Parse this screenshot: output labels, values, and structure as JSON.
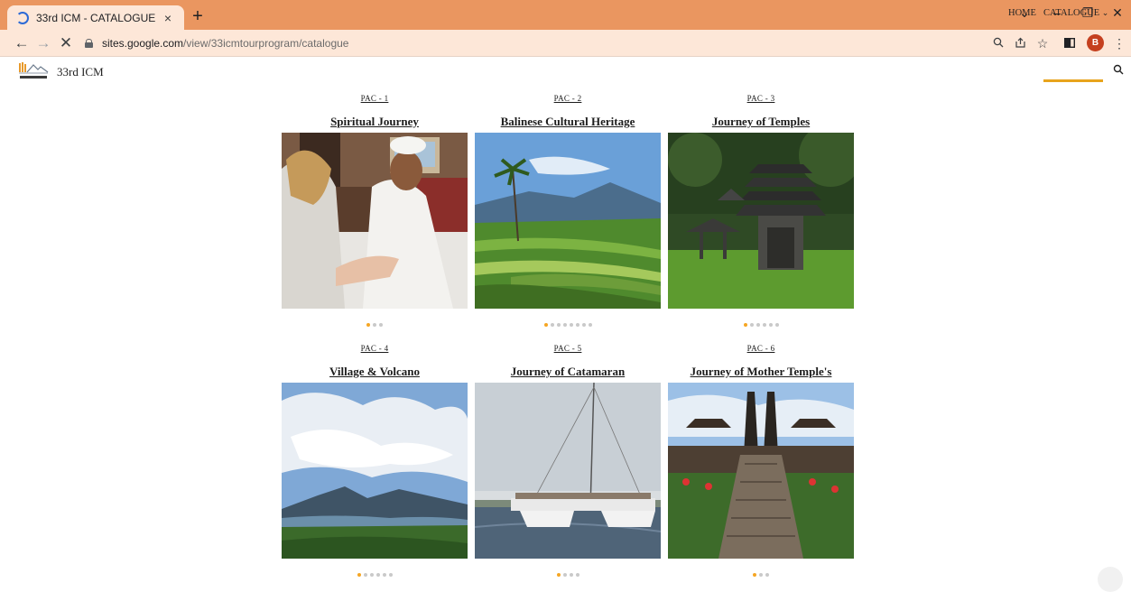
{
  "browser": {
    "tab_title": "33rd ICM - CATALOGUE",
    "tab_close": "×",
    "new_tab": "+",
    "url_host": "sites.google.com",
    "url_path": "/view/33icmtourprogram/catalogue",
    "profile_initial": "B",
    "window_minimize": "–",
    "window_restore": "❐",
    "window_close": "✕",
    "tab_search": "⌄"
  },
  "site": {
    "name": "33rd ICM",
    "nav": {
      "home": "HOME",
      "catalogue": "CATALOGUE"
    }
  },
  "packages": [
    {
      "code": "PAC - 1",
      "title": "Spiritual Journey",
      "slides": 3,
      "active": 0,
      "image": "healer-ritual-photo"
    },
    {
      "code": "PAC - 2",
      "title": "Balinese Cultural Heritage",
      "slides": 8,
      "active": 0,
      "image": "rice-terrace-photo"
    },
    {
      "code": "PAC - 3",
      "title": "Journey of Temples",
      "slides": 6,
      "active": 0,
      "image": "pagoda-temple-photo"
    },
    {
      "code": "PAC - 4",
      "title": "Village & Volcano",
      "slides": 6,
      "active": 0,
      "image": "volcano-lake-photo"
    },
    {
      "code": "PAC - 5",
      "title": "Journey of Catamaran",
      "slides": 4,
      "active": 0,
      "image": "catamaran-photo"
    },
    {
      "code": "PAC - 6",
      "title": "Journey of Mother Temple's",
      "slides": 3,
      "active": 0,
      "image": "mother-temple-photo"
    }
  ],
  "colors": {
    "accent": "#f5a623",
    "tabbar": "#ea9660",
    "toolbar": "#fde7d8"
  }
}
